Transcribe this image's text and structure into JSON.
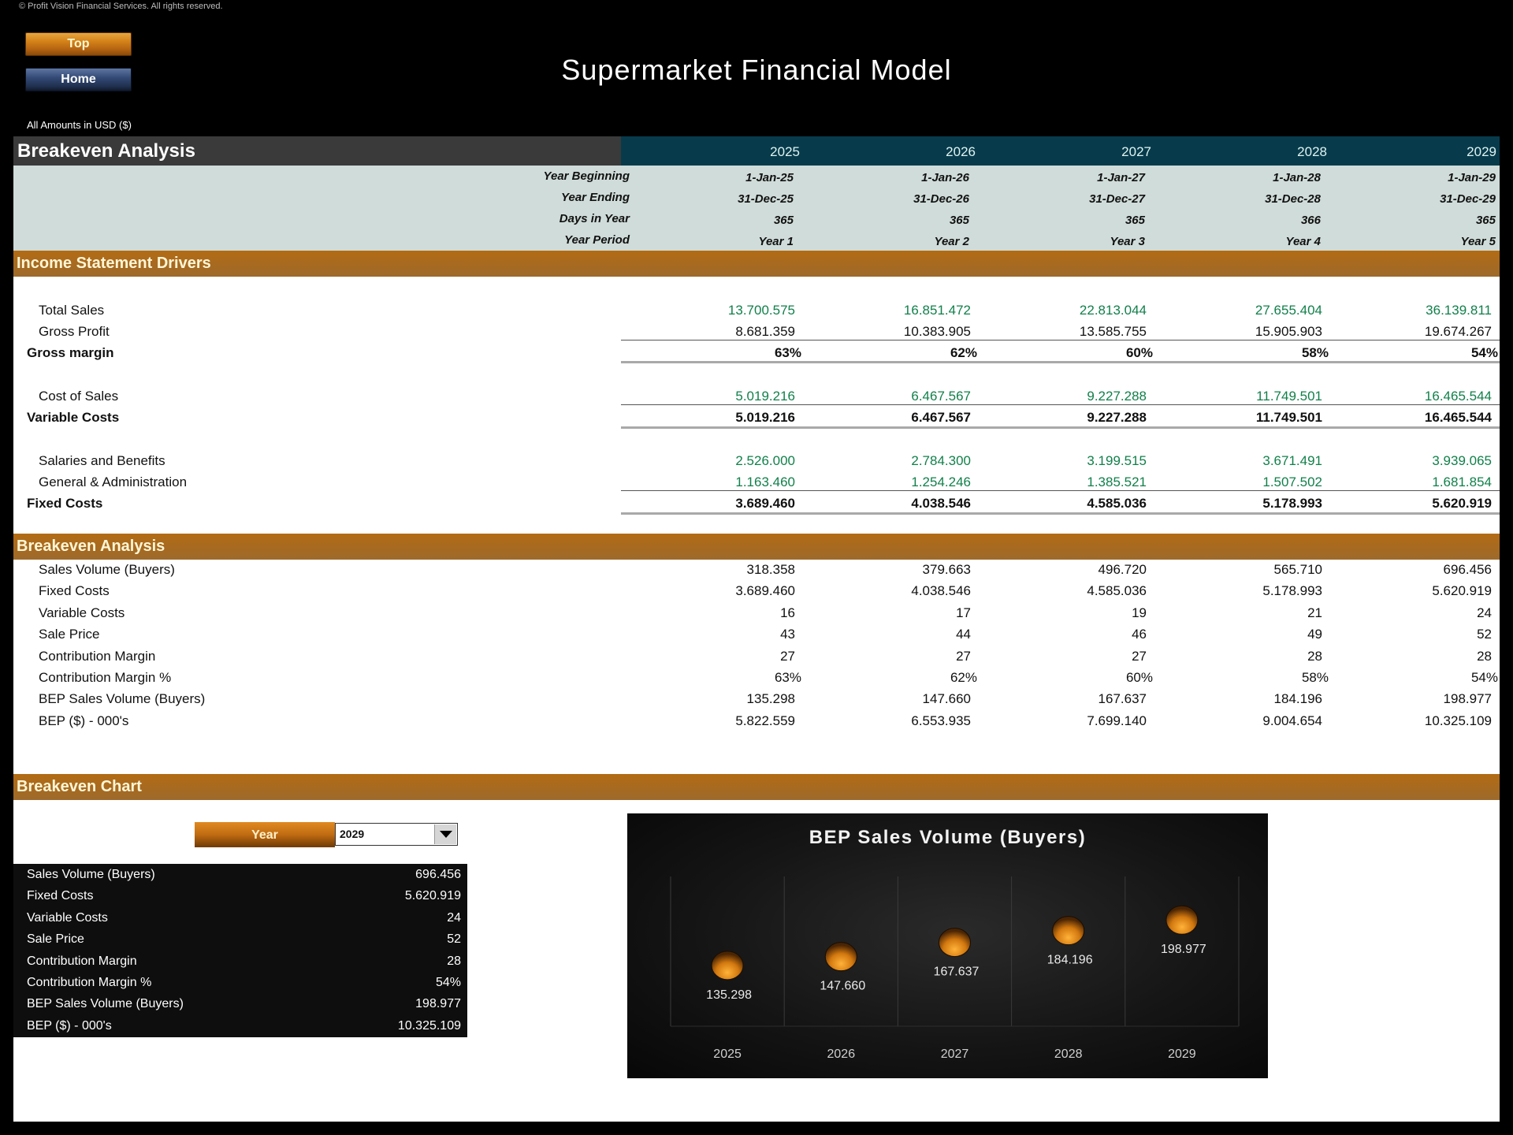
{
  "copyright": "© Profit Vision Financial Services. All rights reserved.",
  "nav": {
    "top_label": "Top",
    "home_label": "Home"
  },
  "title": "Supermarket Financial Model",
  "currency_note": "All Amounts in  USD ($)",
  "header": {
    "section_title": "Breakeven Analysis",
    "years": [
      "2025",
      "2026",
      "2027",
      "2028",
      "2029"
    ],
    "period_rows": [
      {
        "label": "Year Beginning",
        "values": [
          "1-Jan-25",
          "1-Jan-26",
          "1-Jan-27",
          "1-Jan-28",
          "1-Jan-29"
        ]
      },
      {
        "label": "Year Ending",
        "values": [
          "31-Dec-25",
          "31-Dec-26",
          "31-Dec-27",
          "31-Dec-28",
          "31-Dec-29"
        ]
      },
      {
        "label": "Days in Year",
        "values": [
          "365",
          "365",
          "365",
          "366",
          "365"
        ]
      },
      {
        "label": "Year Period",
        "values": [
          "Year 1",
          "Year 2",
          "Year 3",
          "Year 4",
          "Year 5"
        ]
      }
    ]
  },
  "income_drivers": {
    "title": "Income Statement Drivers",
    "rows": [
      {
        "label": "Total Sales",
        "style": "input",
        "values": [
          "13.700.575",
          "16.851.472",
          "22.813.044",
          "27.655.404",
          "36.139.811"
        ]
      },
      {
        "label": "Gross Profit",
        "style": "normal",
        "values": [
          "8.681.359",
          "10.383.905",
          "13.585.755",
          "15.905.903",
          "19.674.267"
        ]
      },
      {
        "label": "Gross margin",
        "style": "total",
        "values": [
          "63%",
          "62%",
          "60%",
          "58%",
          "54%"
        ]
      },
      {
        "label": "Cost of Sales",
        "style": "input",
        "values": [
          "5.019.216",
          "6.467.567",
          "9.227.288",
          "11.749.501",
          "16.465.544"
        ]
      },
      {
        "label": "Variable Costs",
        "style": "total",
        "values": [
          "5.019.216",
          "6.467.567",
          "9.227.288",
          "11.749.501",
          "16.465.544"
        ]
      },
      {
        "label": "Salaries and Benefits",
        "style": "input",
        "values": [
          "2.526.000",
          "2.784.300",
          "3.199.515",
          "3.671.491",
          "3.939.065"
        ]
      },
      {
        "label": "General & Administration",
        "style": "input",
        "values": [
          "1.163.460",
          "1.254.246",
          "1.385.521",
          "1.507.502",
          "1.681.854"
        ]
      },
      {
        "label": "Fixed Costs",
        "style": "total",
        "values": [
          "3.689.460",
          "4.038.546",
          "4.585.036",
          "5.178.993",
          "5.620.919"
        ]
      }
    ]
  },
  "breakeven": {
    "title": "Breakeven Analysis",
    "rows": [
      {
        "label": "Sales Volume (Buyers)",
        "values": [
          "318.358",
          "379.663",
          "496.720",
          "565.710",
          "696.456"
        ]
      },
      {
        "label": "Fixed Costs",
        "values": [
          "3.689.460",
          "4.038.546",
          "4.585.036",
          "5.178.993",
          "5.620.919"
        ]
      },
      {
        "label": "Variable Costs",
        "values": [
          "16",
          "17",
          "19",
          "21",
          "24"
        ]
      },
      {
        "label": "Sale Price",
        "values": [
          "43",
          "44",
          "46",
          "49",
          "52"
        ]
      },
      {
        "label": "Contribution Margin",
        "values": [
          "27",
          "27",
          "27",
          "28",
          "28"
        ]
      },
      {
        "label": "Contribution Margin %",
        "values": [
          "63%",
          "62%",
          "60%",
          "58%",
          "54%"
        ]
      },
      {
        "label": "BEP Sales Volume (Buyers)",
        "values": [
          "135.298",
          "147.660",
          "167.637",
          "184.196",
          "198.977"
        ]
      },
      {
        "label": "BEP ($) - 000's",
        "values": [
          "5.822.559",
          "6.553.935",
          "7.699.140",
          "9.004.654",
          "10.325.109"
        ]
      }
    ]
  },
  "breakeven_chart_section": {
    "title": "Breakeven Chart",
    "year_button_label": "Year",
    "selected_year": "2029",
    "summary": [
      {
        "label": "Sales Volume (Buyers)",
        "value": "696.456"
      },
      {
        "label": "Fixed Costs",
        "value": "5.620.919"
      },
      {
        "label": "Variable Costs",
        "value": "24"
      },
      {
        "label": "Sale Price",
        "value": "52"
      },
      {
        "label": "Contribution Margin",
        "value": "28"
      },
      {
        "label": "Contribution Margin %",
        "value": "54%"
      },
      {
        "label": "BEP Sales Volume (Buyers)",
        "value": "198.977"
      },
      {
        "label": "BEP ($) - 000's",
        "value": "10.325.109"
      }
    ]
  },
  "colors": {
    "section_header": "#A8651A",
    "year_header_bg": "#073B4C",
    "input_green": "#11804A",
    "marker_orange": "#E08A1E"
  },
  "chart_data": {
    "type": "scatter",
    "title": "BEP Sales Volume (Buyers)",
    "categories": [
      "2025",
      "2026",
      "2027",
      "2028",
      "2029"
    ],
    "values": [
      135298,
      147660,
      167637,
      184196,
      198977
    ],
    "labels": [
      "135.298",
      "147.660",
      "167.637",
      "184.196",
      "198.977"
    ],
    "xlabel": "",
    "ylabel": "",
    "grid": "vertical category separators",
    "legend": "none"
  }
}
